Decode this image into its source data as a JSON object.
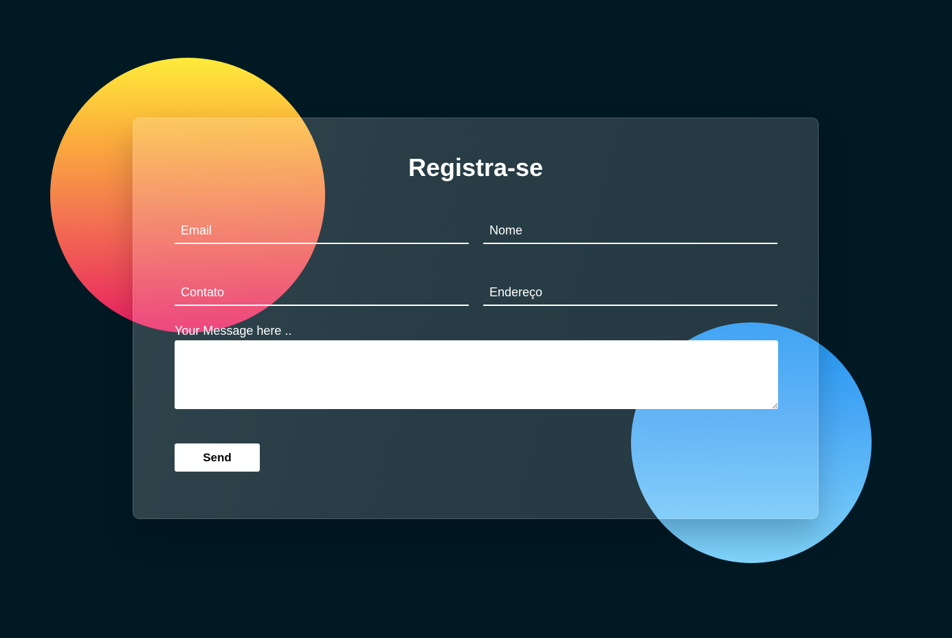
{
  "form": {
    "title": "Registra-se",
    "fields": {
      "email": {
        "placeholder": "Email"
      },
      "nome": {
        "placeholder": "Nome"
      },
      "contato": {
        "placeholder": "Contato"
      },
      "endereco": {
        "placeholder": "Endereço"
      }
    },
    "message": {
      "label": "Your Message here .."
    },
    "submit_label": "Send"
  },
  "colors": {
    "background": "#011923",
    "orange_circle_top": "#ffeb3b",
    "orange_circle_bottom": "#e91e63",
    "blue_circle_top": "#2196f3",
    "blue_circle_bottom": "#81d4fa"
  }
}
